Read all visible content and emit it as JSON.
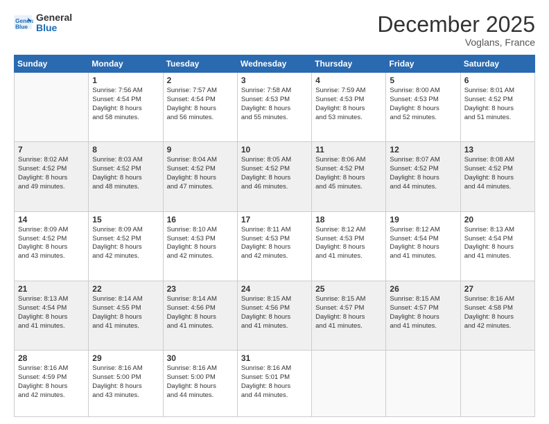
{
  "header": {
    "logo_line1": "General",
    "logo_line2": "Blue",
    "month": "December 2025",
    "location": "Voglans, France"
  },
  "days_of_week": [
    "Sunday",
    "Monday",
    "Tuesday",
    "Wednesday",
    "Thursday",
    "Friday",
    "Saturday"
  ],
  "weeks": [
    [
      {
        "num": "",
        "info": ""
      },
      {
        "num": "1",
        "info": "Sunrise: 7:56 AM\nSunset: 4:54 PM\nDaylight: 8 hours\nand 58 minutes."
      },
      {
        "num": "2",
        "info": "Sunrise: 7:57 AM\nSunset: 4:54 PM\nDaylight: 8 hours\nand 56 minutes."
      },
      {
        "num": "3",
        "info": "Sunrise: 7:58 AM\nSunset: 4:53 PM\nDaylight: 8 hours\nand 55 minutes."
      },
      {
        "num": "4",
        "info": "Sunrise: 7:59 AM\nSunset: 4:53 PM\nDaylight: 8 hours\nand 53 minutes."
      },
      {
        "num": "5",
        "info": "Sunrise: 8:00 AM\nSunset: 4:53 PM\nDaylight: 8 hours\nand 52 minutes."
      },
      {
        "num": "6",
        "info": "Sunrise: 8:01 AM\nSunset: 4:52 PM\nDaylight: 8 hours\nand 51 minutes."
      }
    ],
    [
      {
        "num": "7",
        "info": "Sunrise: 8:02 AM\nSunset: 4:52 PM\nDaylight: 8 hours\nand 49 minutes."
      },
      {
        "num": "8",
        "info": "Sunrise: 8:03 AM\nSunset: 4:52 PM\nDaylight: 8 hours\nand 48 minutes."
      },
      {
        "num": "9",
        "info": "Sunrise: 8:04 AM\nSunset: 4:52 PM\nDaylight: 8 hours\nand 47 minutes."
      },
      {
        "num": "10",
        "info": "Sunrise: 8:05 AM\nSunset: 4:52 PM\nDaylight: 8 hours\nand 46 minutes."
      },
      {
        "num": "11",
        "info": "Sunrise: 8:06 AM\nSunset: 4:52 PM\nDaylight: 8 hours\nand 45 minutes."
      },
      {
        "num": "12",
        "info": "Sunrise: 8:07 AM\nSunset: 4:52 PM\nDaylight: 8 hours\nand 44 minutes."
      },
      {
        "num": "13",
        "info": "Sunrise: 8:08 AM\nSunset: 4:52 PM\nDaylight: 8 hours\nand 44 minutes."
      }
    ],
    [
      {
        "num": "14",
        "info": "Sunrise: 8:09 AM\nSunset: 4:52 PM\nDaylight: 8 hours\nand 43 minutes."
      },
      {
        "num": "15",
        "info": "Sunrise: 8:09 AM\nSunset: 4:52 PM\nDaylight: 8 hours\nand 42 minutes."
      },
      {
        "num": "16",
        "info": "Sunrise: 8:10 AM\nSunset: 4:53 PM\nDaylight: 8 hours\nand 42 minutes."
      },
      {
        "num": "17",
        "info": "Sunrise: 8:11 AM\nSunset: 4:53 PM\nDaylight: 8 hours\nand 42 minutes."
      },
      {
        "num": "18",
        "info": "Sunrise: 8:12 AM\nSunset: 4:53 PM\nDaylight: 8 hours\nand 41 minutes."
      },
      {
        "num": "19",
        "info": "Sunrise: 8:12 AM\nSunset: 4:54 PM\nDaylight: 8 hours\nand 41 minutes."
      },
      {
        "num": "20",
        "info": "Sunrise: 8:13 AM\nSunset: 4:54 PM\nDaylight: 8 hours\nand 41 minutes."
      }
    ],
    [
      {
        "num": "21",
        "info": "Sunrise: 8:13 AM\nSunset: 4:54 PM\nDaylight: 8 hours\nand 41 minutes."
      },
      {
        "num": "22",
        "info": "Sunrise: 8:14 AM\nSunset: 4:55 PM\nDaylight: 8 hours\nand 41 minutes."
      },
      {
        "num": "23",
        "info": "Sunrise: 8:14 AM\nSunset: 4:56 PM\nDaylight: 8 hours\nand 41 minutes."
      },
      {
        "num": "24",
        "info": "Sunrise: 8:15 AM\nSunset: 4:56 PM\nDaylight: 8 hours\nand 41 minutes."
      },
      {
        "num": "25",
        "info": "Sunrise: 8:15 AM\nSunset: 4:57 PM\nDaylight: 8 hours\nand 41 minutes."
      },
      {
        "num": "26",
        "info": "Sunrise: 8:15 AM\nSunset: 4:57 PM\nDaylight: 8 hours\nand 41 minutes."
      },
      {
        "num": "27",
        "info": "Sunrise: 8:16 AM\nSunset: 4:58 PM\nDaylight: 8 hours\nand 42 minutes."
      }
    ],
    [
      {
        "num": "28",
        "info": "Sunrise: 8:16 AM\nSunset: 4:59 PM\nDaylight: 8 hours\nand 42 minutes."
      },
      {
        "num": "29",
        "info": "Sunrise: 8:16 AM\nSunset: 5:00 PM\nDaylight: 8 hours\nand 43 minutes."
      },
      {
        "num": "30",
        "info": "Sunrise: 8:16 AM\nSunset: 5:00 PM\nDaylight: 8 hours\nand 44 minutes."
      },
      {
        "num": "31",
        "info": "Sunrise: 8:16 AM\nSunset: 5:01 PM\nDaylight: 8 hours\nand 44 minutes."
      },
      {
        "num": "",
        "info": ""
      },
      {
        "num": "",
        "info": ""
      },
      {
        "num": "",
        "info": ""
      }
    ]
  ]
}
